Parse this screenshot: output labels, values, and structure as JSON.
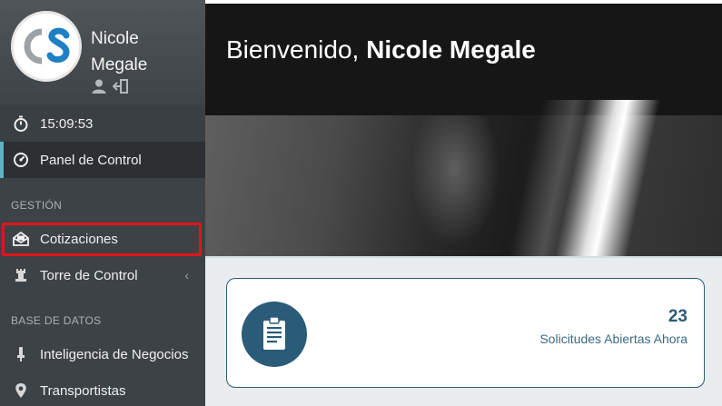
{
  "user": {
    "initials": "CS",
    "first_name": "Nicole",
    "last_name": "Megale",
    "profile_icon": "user-icon",
    "logout_icon": "sign-out-icon"
  },
  "clock": {
    "time": "15:09:53",
    "icon": "stopwatch-icon"
  },
  "nav": {
    "dashboard": {
      "label": "Panel de Control",
      "icon": "dashboard-icon"
    },
    "section_gestion": "GESTIÓN",
    "cotizaciones": {
      "label": "Cotizaciones",
      "icon": "envelope-open-icon"
    },
    "torre": {
      "label": "Torre de Control",
      "icon": "tower-icon",
      "chevron": "‹"
    },
    "section_bd": "BASE DE DATOS",
    "inteligencia": {
      "label": "Inteligencia de Negocios",
      "icon": "pin-icon"
    },
    "transportistas": {
      "label": "Transportistas",
      "icon": "map-marker-icon"
    }
  },
  "hero": {
    "greeting": "Bienvenido, ",
    "name": "Nicole Megale"
  },
  "stat_card": {
    "icon": "clipboard-icon",
    "count": "23",
    "label": "Solicitudes Abiertas Ahora"
  },
  "colors": {
    "sidebar": "#3d4246",
    "active_marker": "#5bb3c4",
    "highlight": "#e0151b",
    "card_accent": "#2a5b78"
  }
}
